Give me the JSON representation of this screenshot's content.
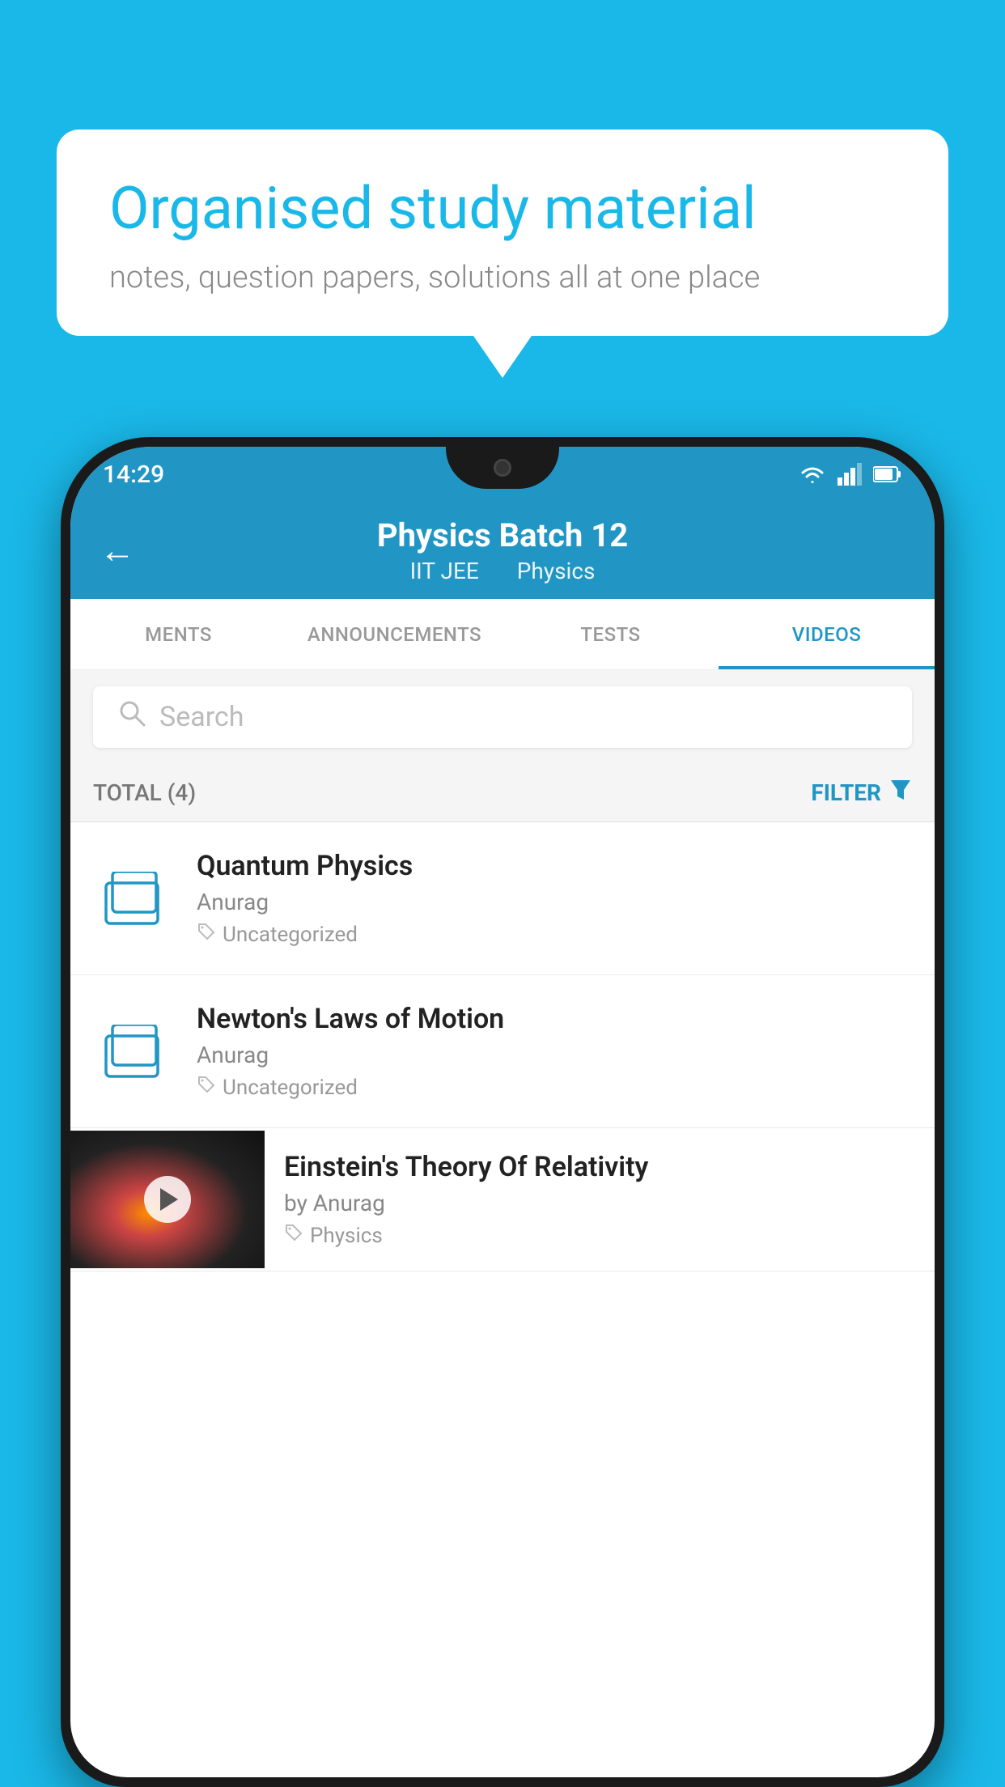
{
  "background_color": "#1ab8e8",
  "bubble": {
    "title": "Organised study material",
    "subtitle": "notes, question papers, solutions all at one place"
  },
  "status_bar": {
    "time": "14:29",
    "wifi": "▾",
    "signal": "▲",
    "battery": "▮"
  },
  "app_bar": {
    "title": "Physics Batch 12",
    "subtitle1": "IIT JEE",
    "subtitle2": "Physics",
    "back_label": "←"
  },
  "tabs": [
    {
      "label": "MENTS",
      "active": false
    },
    {
      "label": "ANNOUNCEMENTS",
      "active": false
    },
    {
      "label": "TESTS",
      "active": false
    },
    {
      "label": "VIDEOS",
      "active": true
    }
  ],
  "search": {
    "placeholder": "Search"
  },
  "filter_bar": {
    "total_label": "TOTAL (4)",
    "filter_label": "FILTER"
  },
  "videos": [
    {
      "id": "v1",
      "title": "Quantum Physics",
      "author": "Anurag",
      "tag": "Uncategorized",
      "has_thumbnail": false
    },
    {
      "id": "v2",
      "title": "Newton's Laws of Motion",
      "author": "Anurag",
      "tag": "Uncategorized",
      "has_thumbnail": false
    },
    {
      "id": "v3",
      "title": "Einstein's Theory Of Relativity",
      "author": "by Anurag",
      "tag": "Physics",
      "has_thumbnail": true
    }
  ]
}
